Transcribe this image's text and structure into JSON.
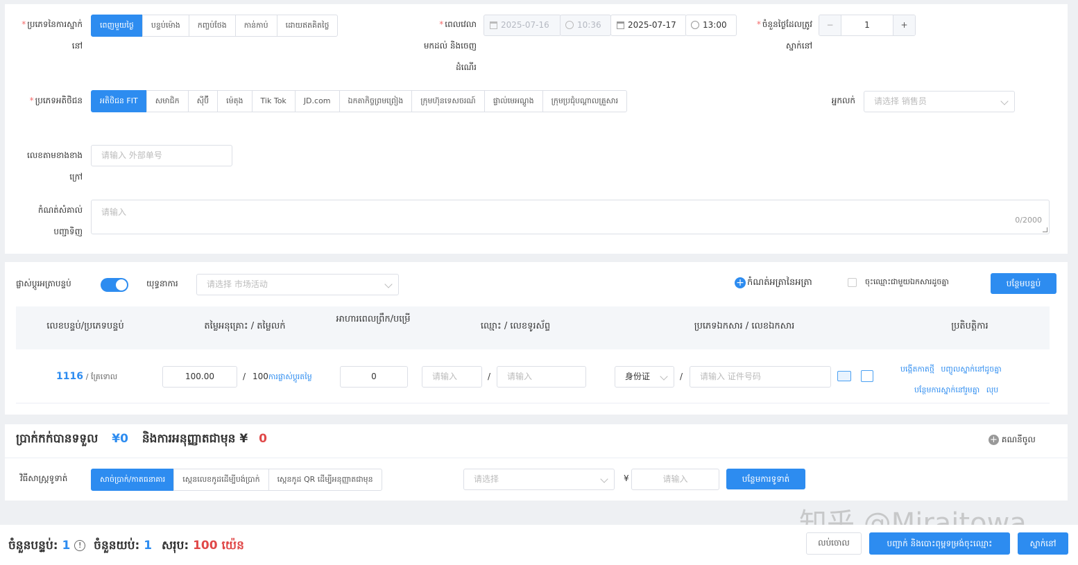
{
  "booking": {
    "type_label": "ប្រភេទនៃការស្នាក់នៅ",
    "types": [
      "ពេញមួយថ្ងៃ",
      "បន្ទប់ម៉ោង",
      "កញ្ចប់ថែង",
      "កាន់កាប់",
      "ដោយឥតគិតថ្លៃ"
    ],
    "time_label": "ពេលវេលាមកដល់ និងចេញដំណើរ",
    "checkin_date": "2025-07-16",
    "checkin_time": "10:36",
    "checkout_date": "2025-07-17",
    "checkout_time": "13:00",
    "days_label": "ចំនួនថ្ងៃដែលត្រូវស្នាក់នៅ",
    "days_minus": "−",
    "days_value": "1",
    "days_plus": "+",
    "guest_type_label": "ប្រភេទអតិថិជន",
    "guest_types": [
      "អតិថិជន FIT",
      "សមាជិក",
      "ស៊ីប៊ី",
      "ម៉េតុង",
      "Tik Tok",
      "JD.com",
      "ឯកតាកិច្ចព្រមព្រៀង",
      "ក្រុមហ៊ុនទេសចរណ៍",
      "ផ្ទាល់មេអណ្ដូង",
      "ក្រុមប្រជុំបណ្ដាលគ្រួសារ"
    ],
    "seller_label": "អ្នកលក់",
    "seller_placeholder": "请选择 销售员",
    "external_label": "លេខតាមខាងខាងក្រៅ",
    "external_placeholder": "请输入 外部单号",
    "remark_label": "កំណត់សំគាល់បញ្ជាទិញ",
    "remark_placeholder": "请输入",
    "remark_counter": "0/2000"
  },
  "rooms": {
    "toggle_label": "ផ្លាស់ប្ដូរអត្រាបន្ទប់",
    "campaign_label": "យុទ្ធនាការ",
    "campaign_placeholder": "请选择 市场活动",
    "set_rate_label": "កំណត់អត្រានៃអត្រា",
    "same_name_label": "ចុះឈ្មោះជាមួយឯកសារដូចគ្នា",
    "add_room_button": "បន្ថែមបន្ទប់",
    "headers": [
      "លេខបន្ទប់/ប្រភេទបន្ទប់",
      "តម្លៃអនុគ្រោះ / តម្លៃលក់",
      "អាហារពេលព្រឹក/បម្រើ",
      "ឈ្មោះ / លេខទូរស័ព្ទ",
      "ប្រភេទឯកសារ / លេខឯកសារ",
      "ប្រតិបត្តិការ"
    ],
    "row": {
      "room_no": "1116",
      "room_type": "/ គ្រែទោល",
      "discount_price": "100.00",
      "sep": "/",
      "sale_price": "100",
      "change_rate_link": "ការផ្លាស់ប្ដូរតម្លៃ",
      "breakfast": "0",
      "name_placeholder": "请输入",
      "phone_placeholder": "请输入",
      "doc_type": "身份证",
      "doc_placeholder": "请输入 证件号码",
      "actions": [
        "បង្កើតកាតថ្មី",
        "បញ្ចូលស្នាក់នៅដូចគ្នា",
        "បន្ថែមការស្នាក់នៅរួមគ្នា",
        "លុប"
      ]
    }
  },
  "payment": {
    "received_label": "ប្រាក់កក់បានទទួល",
    "received_amount": "¥0",
    "preauth_label": "និងការអនុញ្ញាតជាមុន ¥",
    "preauth_amount": "0",
    "calc_link": "គណនីចូល",
    "method_label": "វិធីសាស្ត្រទូទាត់",
    "methods": [
      "សាច់ប្រាក់/កាតធនាគារ",
      "ស្កេនលេខកូដដើម្បីបង់ប្រាក់",
      "ស្កេនកូដ QR ដើម្បីអនុញ្ញាតជាមុន"
    ],
    "select_placeholder": "请选择",
    "currency": "¥",
    "amount_placeholder": "请输入",
    "add_payment_button": "បន្ថែមការទូទាត់"
  },
  "footer": {
    "rooms_label": "ចំនួនបន្ទប់:",
    "rooms_count": "1",
    "nights_label": "ចំនួនយប់:",
    "nights_count": "1",
    "total_label": "សរុប:",
    "total_amount": "100 យ៉េន",
    "cancel_button": "លប់ចោល",
    "confirm_print_button": "បញ្ជាក់ និងបោះពុម្ពទម្រង់ចុះឈ្មោះ",
    "checkin_button": "ស្នាក់នៅ"
  },
  "watermark": "知乎 @Miraitowa",
  "colors": {
    "accent": "#2d8cf0",
    "danger": "#e04848",
    "border": "#dcdfe6"
  }
}
